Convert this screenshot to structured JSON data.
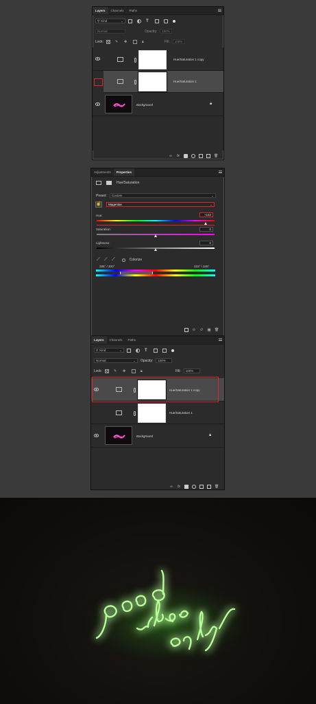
{
  "layers_panel_top": {
    "tabs": [
      "Layers",
      "Channels",
      "Paths"
    ],
    "filter_kind": "Kind",
    "blend_mode": "Normal",
    "opacity_label": "Opacity:",
    "opacity_value": "100%",
    "lock_label": "Lock:",
    "fill_label": "Fill:",
    "fill_value": "100%",
    "layers": [
      {
        "name": "Hue/Saturation 1 copy"
      },
      {
        "name": "Hue/Saturation 1"
      },
      {
        "name": "Background"
      }
    ]
  },
  "properties_panel": {
    "tabs": [
      "Adjustments",
      "Properties"
    ],
    "adjustment_title": "Hue/Saturation",
    "preset_label": "Preset:",
    "preset_value": "Custom",
    "channel_value": "Magentas",
    "hue_label": "Hue:",
    "hue_value": "+153",
    "saturation_label": "Saturation:",
    "saturation_value": "0",
    "lightness_label": "Lightness:",
    "lightness_value": "0",
    "colorize_label": "Colorize",
    "range_left": "285° / 300°",
    "range_right": "315° \\ 345°",
    "hue_slider_fraction": 0.925,
    "saturation_slider_fraction": 0.5,
    "lightness_slider_fraction": 0.5
  },
  "layers_panel_bottom": {
    "tabs": [
      "Layers",
      "Channels",
      "Paths"
    ],
    "filter_kind": "Kind",
    "blend_mode": "Normal",
    "opacity_label": "Opacity:",
    "opacity_value": "100%",
    "lock_label": "Lock:",
    "fill_label": "Fill:",
    "fill_value": "100%",
    "layers": [
      {
        "name": "Hue/Saturation 1 copy"
      },
      {
        "name": "Hue/Saturation 1"
      },
      {
        "name": "Background"
      }
    ]
  },
  "colors": {
    "highlight_red": "#e0262a",
    "neon_green": "#4dff3a",
    "neon_pink": "#ff3cc8"
  }
}
